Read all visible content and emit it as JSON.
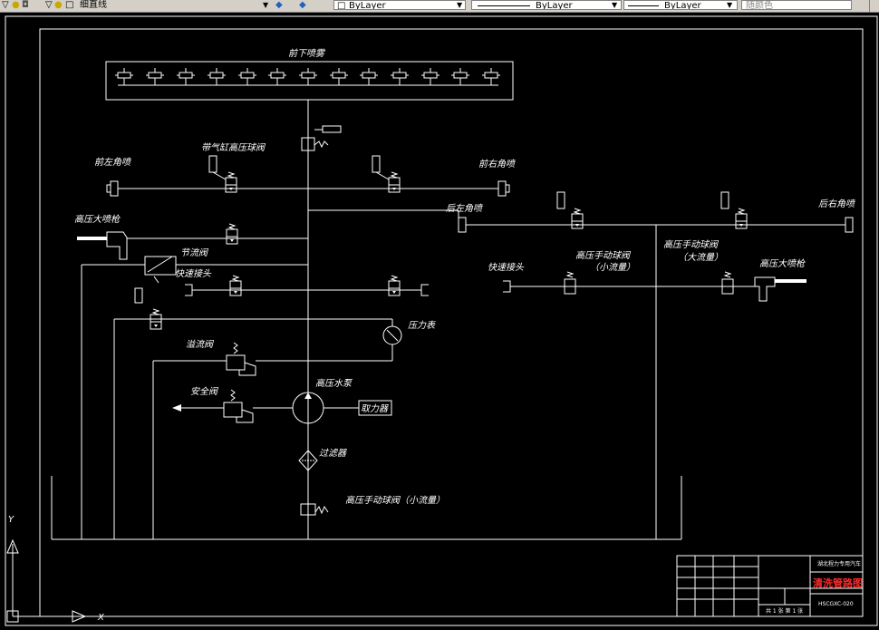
{
  "toolbar": {
    "linetype_text": "细直线",
    "layer_color": "ByLayer",
    "layer_linetype": "ByLayer",
    "layer_lineweight": "ByLayer",
    "plot_style": "随颜色"
  },
  "drawing": {
    "title_top": "前下喷雾",
    "front_left_nozzle": "前左角喷",
    "front_right_nozzle": "前右角喷",
    "cylinder_ball_valve": "带气缸高压球阀",
    "hp_gun_left": "高压大喷枪",
    "throttle_valve": "节流阀",
    "quick_coupler_left": "快速接头",
    "rear_left_nozzle": "后左角喷",
    "rear_right_nozzle": "后右角喷",
    "quick_coupler_right": "快速接头",
    "manual_valve_small": "高压手动球阀",
    "manual_valve_small_sub": "（小流量）",
    "manual_valve_large": "高压手动球阀",
    "manual_valve_large_sub": "（大流量）",
    "hp_gun_right": "高压大喷枪",
    "pressure_gauge": "压力表",
    "overflow_valve": "溢流阀",
    "hp_pump": "高压水泵",
    "safety_valve": "安全阀",
    "pto": "取力器",
    "filter": "过滤器",
    "bottom_manual_valve": "高压手动球阀（小流量）"
  },
  "title_block": {
    "drawing_name": "清洗管路图",
    "drawing_code": "HSCGXC-020",
    "company": "湖北程力专用汽车",
    "sheet_info": "共 1 张  第 1 张"
  }
}
